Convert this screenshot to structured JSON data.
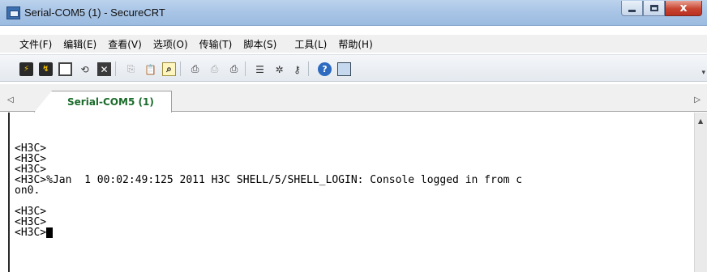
{
  "window": {
    "title": "Serial-COM5 (1) - SecureCRT",
    "minimize_icon": "minimize-icon",
    "maximize_icon": "maximize-icon",
    "close_icon": "close-icon",
    "close_glyph": "x"
  },
  "menu": [
    "文件(F)",
    "编辑(E)",
    "查看(V)",
    "选项(O)",
    "传输(T)",
    "脚本(S)",
    "工具(L)",
    "帮助(H)"
  ],
  "toolbar_icons": [
    "connect-icon",
    "quick-connect-icon",
    "connect-tab-icon",
    "reconnect-icon",
    "disconnect-icon",
    "copy-icon",
    "paste-icon",
    "find-icon",
    "print-icon",
    "print-selection-icon",
    "print-setup-icon",
    "session-options-icon",
    "global-options-icon",
    "keymap-icon",
    "help-icon",
    "screen-icon"
  ],
  "tabs": {
    "left_arrow_icon": "chevron-left-icon",
    "right_arrow_icon": "chevron-right-icon",
    "active_label": "Serial-COM5 (1)",
    "active_color": "#1a6b2a"
  },
  "terminal": {
    "lines": [
      "<H3C>",
      "<H3C>",
      "<H3C>",
      "<H3C>%Jan  1 00:02:49:125 2011 H3C SHELL/5/SHELL_LOGIN: Console logged in from c",
      "on0.",
      "",
      "<H3C>",
      "<H3C>",
      "<H3C>"
    ]
  },
  "colors": {
    "titlebar": "#a9c5e6",
    "close_button": "#c84532",
    "terminal_bg": "#ffffff"
  }
}
